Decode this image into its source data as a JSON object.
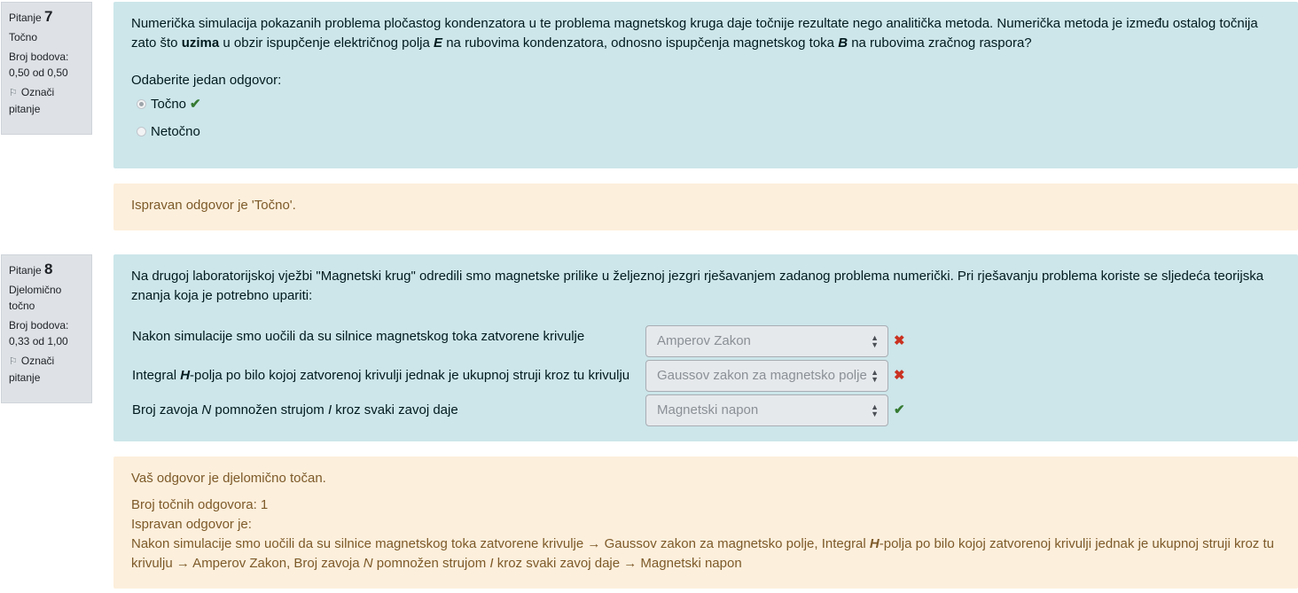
{
  "q7": {
    "label": "Pitanje",
    "number": "7",
    "state": "Točno",
    "grade_label": "Broj bodova:",
    "grade_value": "0,50 od 0,50",
    "flag_label": "Označi",
    "flag_label2": "pitanje",
    "text_a": "Numerička simulacija pokazanih problema pločastog kondenzatora u te problema magnetskog kruga daje točnije rezultate nego analitička metoda. Numerička metoda je između ostalog točnija zato što ",
    "text_bold": "uzima",
    "text_b": " u obzir ispupčenje električnog polja ",
    "text_E": "E",
    "text_c": " na rubovima kondenzatora, odnosno ispupčenja magnetskog toka ",
    "text_B": "B",
    "text_d": " na rubovima zračnog raspora?",
    "prompt": "Odaberite jedan odgovor:",
    "option_true": "Točno",
    "option_false": "Netočno",
    "feedback": "Ispravan odgovor je 'Točno'."
  },
  "q8": {
    "label": "Pitanje",
    "number": "8",
    "state_1": "Djelomično",
    "state_2": "točno",
    "grade_label": "Broj bodova:",
    "grade_value": "0,33 od 1,00",
    "flag_label": "Označi",
    "flag_label2": "pitanje",
    "text": "Na drugoj laboratorijskoj vježbi \"Magnetski krug\" odredili smo magnetske prilike u željeznoj jezgri rješavanjem zadanog problema numerički. Pri rješavanju problema koriste se sljedeća teorijska znanja koja je potrebno upariti:",
    "row1_text": "Nakon simulacije smo uočili da su silnice magnetskog toka zatvorene krivulje",
    "row1_select": "Amperov Zakon",
    "row2_text_a": "Integral ",
    "row2_H": "H",
    "row2_text_b": "-polja po bilo kojoj zatvorenoj krivulji jednak je ukupnoj struji kroz tu krivulju",
    "row2_select": "Gaussov zakon za magnetsko polje",
    "row3_text_a": "Broj zavoja ",
    "row3_N": "N",
    "row3_text_b": " pomnožen strujom ",
    "row3_I": "I",
    "row3_text_c": " kroz svaki zavoj daje",
    "row3_select": "Magnetski napon",
    "fb_partial": "Vaš odgovor je djelomično točan.",
    "fb_count": "Broj točnih odgovora: 1",
    "fb_correct_label": "Ispravan odgovor je:",
    "fb_ans_a": "Nakon simulacije smo uočili da su silnice magnetskog toka zatvorene krivulje → Gaussov zakon za magnetsko polje, Integral ",
    "fb_ans_H": "H",
    "fb_ans_b": "-polja po bilo kojoj zatvorenoj krivulji jednak je ukupnoj struji kroz tu krivulju → Amperov Zakon, Broj zavoja ",
    "fb_ans_N": "N",
    "fb_ans_c": " pomnožen strujom ",
    "fb_ans_I": "I",
    "fb_ans_d": " kroz svaki zavoj daje → Magnetski napon"
  },
  "icons": {
    "check": "check-icon",
    "cross": "cross-icon",
    "flag": "flag-icon",
    "select": "select-arrows-icon"
  },
  "colors": {
    "formulation_bg": "#cce6ea",
    "feedback_bg": "#fcefdc",
    "info_bg": "#dee2e6",
    "correct": "#357a32",
    "incorrect": "#ca3120"
  }
}
